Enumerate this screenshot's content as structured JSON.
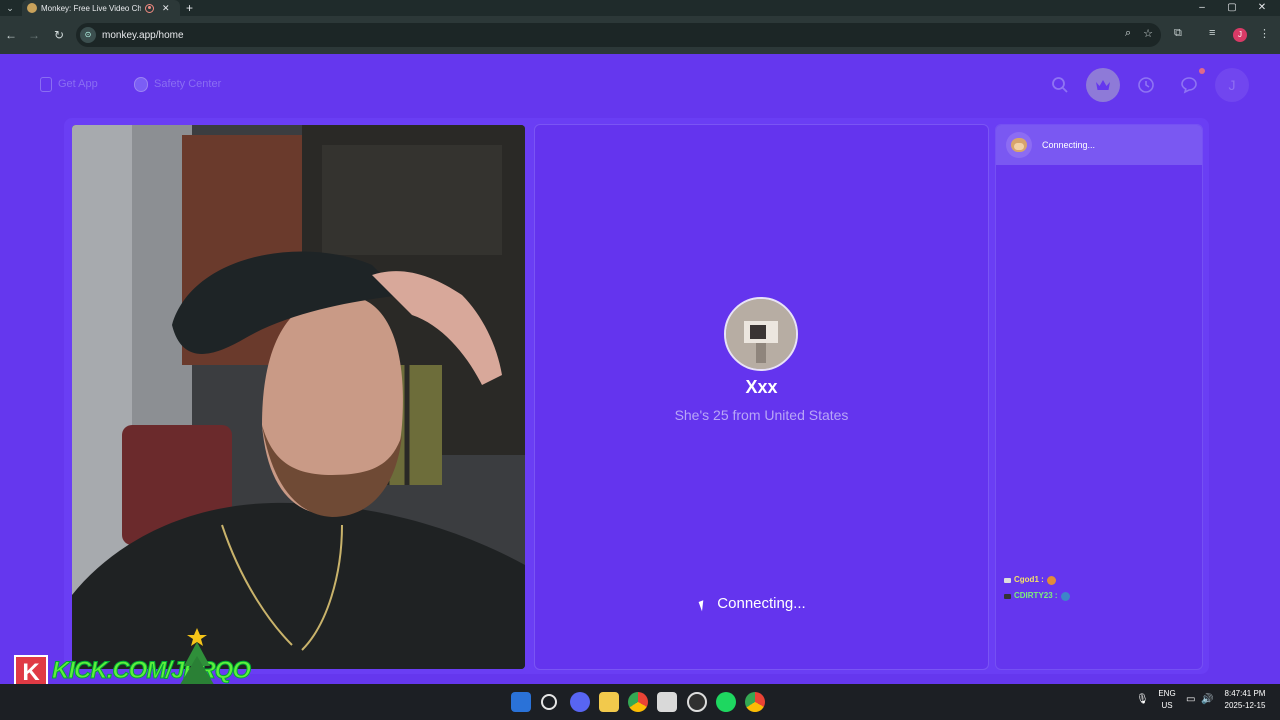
{
  "browser": {
    "tab_title": "Monkey: Free Live Video Ch",
    "tab_close": "✕",
    "new_tab": "+",
    "url": "monkey.app/home",
    "window_controls": [
      "–",
      "▢",
      "✕"
    ],
    "profile_initial": "J"
  },
  "header": {
    "get_app_label": "Get App",
    "safety_center_label": "Safety Center",
    "avatar_initial": "J"
  },
  "partner": {
    "name": "Xxx",
    "subtitle": "She's 25 from United States",
    "status": "Connecting..."
  },
  "chat": {
    "status": "Connecting..."
  },
  "stream_chat": [
    {
      "user": "Cgod1 :"
    },
    {
      "user": "CDIRTY23 :"
    }
  ],
  "overlay": {
    "kick_logo": "K",
    "kick_text": "KICK.COM/JERQO"
  },
  "taskbar": {
    "lang_line1": "ENG",
    "lang_line2": "US",
    "time": "8:47:41 PM",
    "date": "2025-12-15"
  },
  "colors": {
    "page_bg": "#6537ee",
    "panel_bg": "#6434ee",
    "accent_text": "#b8a6f7"
  },
  "icons": [
    "search-icon",
    "crown-icon",
    "history-icon",
    "chat-icon",
    "phone-icon",
    "shield-icon",
    "monkey-icon",
    "cursor-icon"
  ]
}
